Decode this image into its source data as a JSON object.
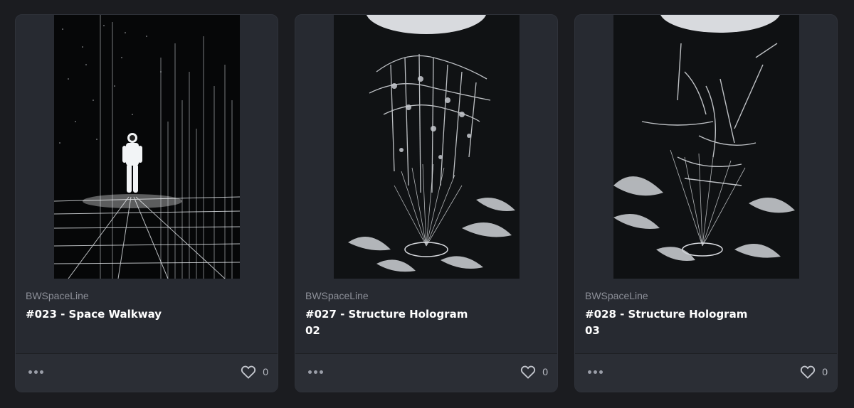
{
  "cards": [
    {
      "collection": "BWSpaceLine",
      "title": "#023 - Space Walkway",
      "likes": "0",
      "image": "astronaut-in-grid-corridor"
    },
    {
      "collection": "BWSpaceLine",
      "title": "#027 - Structure Hologram 02",
      "likes": "0",
      "image": "wireframe-structure-hologram"
    },
    {
      "collection": "BWSpaceLine",
      "title": "#028 - Structure Hologram 03",
      "likes": "0",
      "image": "wireframe-structure-hologram"
    }
  ],
  "icons": {
    "menu": "more-horizontal-icon",
    "like": "heart-icon"
  },
  "colors": {
    "background": "#1b1c20",
    "card": "#272a31",
    "text_primary": "#ffffff",
    "text_secondary": "#8d9099"
  }
}
